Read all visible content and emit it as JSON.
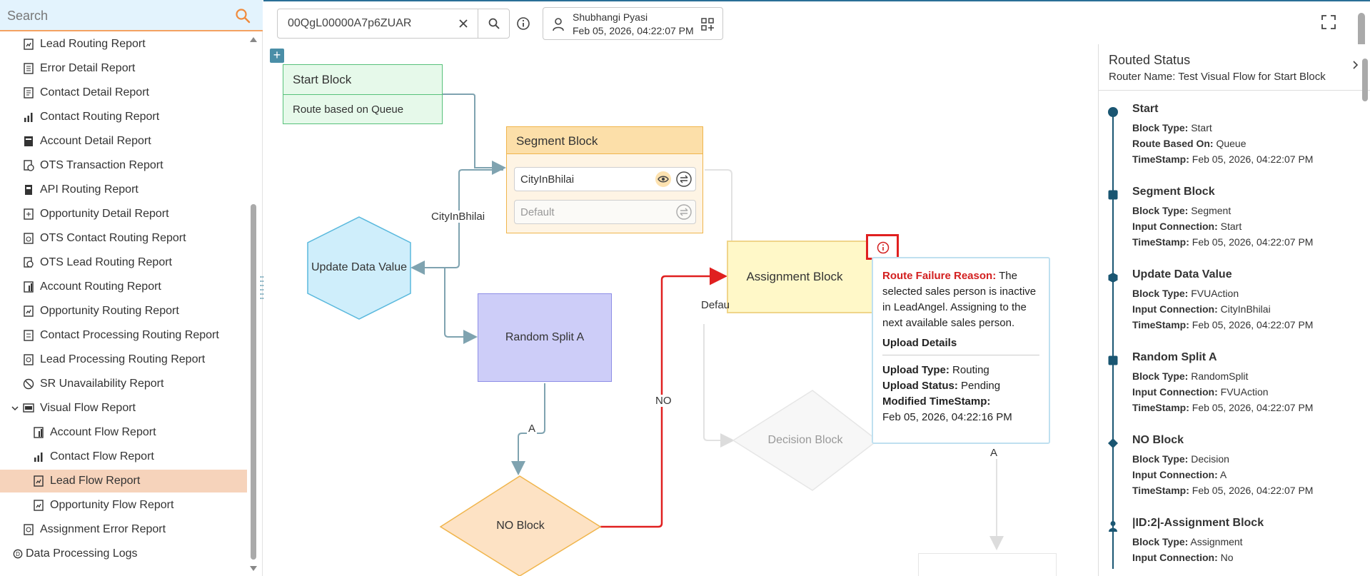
{
  "sidebar": {
    "search_placeholder": "Search",
    "items": [
      {
        "label": "Lead Routing Report",
        "icon": "report-icon"
      },
      {
        "label": "Error Detail Report",
        "icon": "report-icon"
      },
      {
        "label": "Contact Detail Report",
        "icon": "report-icon"
      },
      {
        "label": "Contact Routing Report",
        "icon": "chart-icon"
      },
      {
        "label": "Account Detail Report",
        "icon": "report-icon"
      },
      {
        "label": "OTS Transaction Report",
        "icon": "report-icon"
      },
      {
        "label": "API Routing Report",
        "icon": "report-icon"
      },
      {
        "label": "Opportunity Detail Report",
        "icon": "report-icon"
      },
      {
        "label": "OTS Contact Routing Report",
        "icon": "report-icon"
      },
      {
        "label": "OTS Lead Routing Report",
        "icon": "report-icon"
      },
      {
        "label": "Account Routing Report",
        "icon": "report-icon"
      },
      {
        "label": "Opportunity Routing Report",
        "icon": "report-icon"
      },
      {
        "label": "Contact Processing Routing Report",
        "icon": "report-icon"
      },
      {
        "label": "Lead Processing Routing Report",
        "icon": "report-icon"
      },
      {
        "label": "SR Unavailability Report",
        "icon": "report-icon"
      },
      {
        "label": "Visual Flow Report",
        "icon": "report-icon"
      },
      {
        "label": "Account Flow Report",
        "icon": "report-icon"
      },
      {
        "label": "Contact Flow Report",
        "icon": "chart-icon"
      },
      {
        "label": "Lead Flow Report",
        "icon": "report-icon"
      },
      {
        "label": "Opportunity Flow Report",
        "icon": "report-icon"
      },
      {
        "label": "Assignment Error Report",
        "icon": "report-icon"
      },
      {
        "label": "Data Processing Logs",
        "icon": "report-icon"
      }
    ]
  },
  "toolbar": {
    "record_id": "00QgL00000A7p6ZUAR",
    "user_name": "Shubhangi Pyasi",
    "user_time": "Feb 05, 2026, 04:22:07 PM"
  },
  "flow": {
    "add_label": "+",
    "start_block": {
      "title": "Start Block",
      "sub": "Route based on Queue"
    },
    "segment_block": {
      "title": "Segment Block",
      "input1": "CityInBhilai",
      "input2_placeholder": "Default"
    },
    "edge_cityinbhilai": "CityInBhilai",
    "update_block": "Update Data Value",
    "random_block": "Random Split A",
    "edge_a1": "A",
    "edge_no": "NO",
    "no_block": "NO Block",
    "assignment_block": "Assignment Block",
    "edge_default": "Defau",
    "decision_block": "Decision Block",
    "edge_a2": "A"
  },
  "tooltip": {
    "reason_label": "Route Failure Reason:",
    "reason_text": " The selected sales person is inactive in LeadAngel. Assigning to the next available sales person.",
    "upload_heading": "Upload Details",
    "upload_type_label": "Upload Type:",
    "upload_type": " Routing",
    "upload_status_label": "Upload Status:",
    "upload_status": " Pending",
    "modified_label": "Modified TimeStamp:",
    "modified_value": "Feb 05, 2026, 04:22:16 PM"
  },
  "status_panel": {
    "title": "Routed Status",
    "router_name": "Router Name: Test Visual Flow for Start Block",
    "steps": [
      {
        "name": "Start",
        "lines": [
          [
            "Block Type:",
            " Start"
          ],
          [
            "Route Based On:",
            " Queue"
          ],
          [
            "TimeStamp:",
            " Feb 05, 2026, 04:22:07 PM"
          ]
        ]
      },
      {
        "name": "Segment Block",
        "lines": [
          [
            "Block Type:",
            " Segment"
          ],
          [
            "Input Connection:",
            " Start"
          ],
          [
            "TimeStamp:",
            " Feb 05, 2026, 04:22:07 PM"
          ]
        ]
      },
      {
        "name": "Update Data Value",
        "lines": [
          [
            "Block Type:",
            " FVUAction"
          ],
          [
            "Input Connection:",
            " CityInBhilai"
          ],
          [
            "TimeStamp:",
            " Feb 05, 2026, 04:22:07 PM"
          ]
        ]
      },
      {
        "name": "Random Split A",
        "lines": [
          [
            "Block Type:",
            " RandomSplit"
          ],
          [
            "Input Connection:",
            " FVUAction"
          ],
          [
            "TimeStamp:",
            " Feb 05, 2026, 04:22:07 PM"
          ]
        ]
      },
      {
        "name": "NO Block",
        "lines": [
          [
            "Block Type:",
            " Decision"
          ],
          [
            "Input Connection:",
            " A"
          ],
          [
            "TimeStamp:",
            " Feb 05, 2026, 04:22:07 PM"
          ]
        ]
      },
      {
        "name": "|ID:2|-Assignment Block",
        "lines": [
          [
            "Block Type:",
            " Assignment"
          ],
          [
            "Input Connection:",
            " No"
          ]
        ]
      }
    ]
  },
  "colors": {
    "accent": "#1a5672",
    "active_item": "#f6d3bb",
    "failure": "#e02020"
  }
}
